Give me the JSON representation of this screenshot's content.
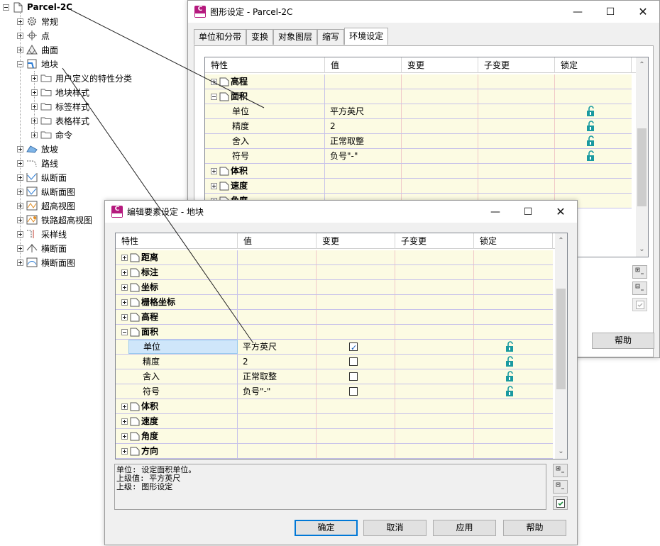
{
  "tree": {
    "root": "Parcel-2C",
    "items": [
      {
        "label": "常规",
        "icon": "gear-icon"
      },
      {
        "label": "点",
        "icon": "point-icon"
      },
      {
        "label": "曲面",
        "icon": "surface-icon"
      },
      {
        "label": "地块",
        "icon": "parcel-icon"
      },
      {
        "label": "用户定义的特性分类",
        "icon": "folder-icon"
      },
      {
        "label": "地块样式",
        "icon": "folder-icon"
      },
      {
        "label": "标签样式",
        "icon": "folder-icon"
      },
      {
        "label": "表格样式",
        "icon": "folder-icon"
      },
      {
        "label": "命令",
        "icon": "folder-icon"
      },
      {
        "label": "放坡",
        "icon": "grading-icon"
      },
      {
        "label": "路线",
        "icon": "alignment-icon"
      },
      {
        "label": "纵断面",
        "icon": "profile-icon"
      },
      {
        "label": "纵断面图",
        "icon": "profile-view-icon"
      },
      {
        "label": "超高视图",
        "icon": "superelevation-icon"
      },
      {
        "label": "铁路超高视图",
        "icon": "rail-superelevation-icon"
      },
      {
        "label": "采样线",
        "icon": "sample-line-icon"
      },
      {
        "label": "横断面",
        "icon": "section-icon"
      },
      {
        "label": "横断面图",
        "icon": "section-view-icon"
      }
    ]
  },
  "drawing_settings": {
    "title": "图形设定 - Parcel-2C",
    "app_icon_text": "C",
    "tabs": [
      "单位和分带",
      "变换",
      "对象图层",
      "缩写",
      "环境设定"
    ],
    "active_tab": "环境设定",
    "columns": [
      "特性",
      "值",
      "变更",
      "子变更",
      "锁定"
    ],
    "rows": [
      {
        "kind": "category",
        "label": "高程",
        "expanded": false
      },
      {
        "kind": "category",
        "label": "面积",
        "expanded": true
      },
      {
        "kind": "property",
        "label": "单位",
        "value": "平方英尺"
      },
      {
        "kind": "property",
        "label": "精度",
        "value": "2"
      },
      {
        "kind": "property",
        "label": "舍入",
        "value": "正常取整"
      },
      {
        "kind": "property",
        "label": "符号",
        "value": "负号\"-\""
      },
      {
        "kind": "category",
        "label": "体积",
        "expanded": false
      },
      {
        "kind": "category",
        "label": "速度",
        "expanded": false
      },
      {
        "kind": "category",
        "label": "角度",
        "expanded": false
      }
    ],
    "help_label": "帮助"
  },
  "edit_feature_settings": {
    "title": "编辑要素设定 - 地块",
    "app_icon_text": "C",
    "columns": [
      "特性",
      "值",
      "变更",
      "子变更",
      "锁定"
    ],
    "rows": [
      {
        "kind": "category",
        "label": "距离"
      },
      {
        "kind": "category",
        "label": "标注"
      },
      {
        "kind": "category",
        "label": "坐标"
      },
      {
        "kind": "category",
        "label": "栅格坐标"
      },
      {
        "kind": "category",
        "label": "高程"
      },
      {
        "kind": "category",
        "label": "面积",
        "expanded": true
      },
      {
        "kind": "property",
        "label": "单位",
        "value": "平方英尺",
        "override": true,
        "selected": true
      },
      {
        "kind": "property",
        "label": "精度",
        "value": "2",
        "override": false
      },
      {
        "kind": "property",
        "label": "舍入",
        "value": "正常取整",
        "override": false
      },
      {
        "kind": "property",
        "label": "符号",
        "value": "负号\"-\"",
        "override": false
      },
      {
        "kind": "category",
        "label": "体积"
      },
      {
        "kind": "category",
        "label": "速度"
      },
      {
        "kind": "category",
        "label": "角度"
      },
      {
        "kind": "category",
        "label": "方向"
      }
    ],
    "description_lines": [
      "单位: 设定面积单位。",
      "上级值: 平方英尺",
      "上级: 图形设定"
    ],
    "buttons": {
      "ok": "确定",
      "cancel": "取消",
      "apply": "应用",
      "help": "帮助"
    }
  },
  "colors": {
    "grid_row": "#fcfbe3",
    "lock": "#1a9aa0",
    "app_icon": "#b5197e",
    "selection": "#cfe6fa",
    "default_button_border": "#0078d7"
  }
}
